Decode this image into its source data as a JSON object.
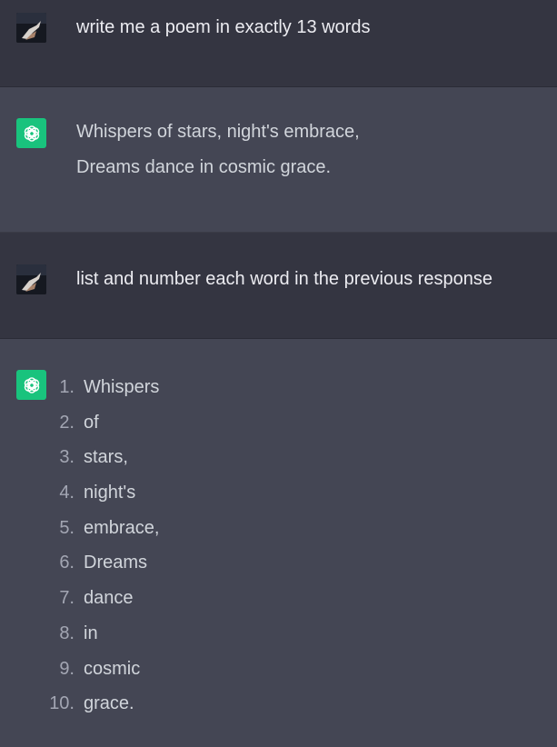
{
  "conversation": [
    {
      "role": "user",
      "lines": [
        "write me a poem in exactly 13 words"
      ]
    },
    {
      "role": "assistant",
      "lines": [
        "Whispers of stars, night's embrace,",
        "Dreams dance in cosmic grace."
      ]
    },
    {
      "role": "user",
      "lines": [
        "list and number each word in the previous response"
      ]
    },
    {
      "role": "assistant",
      "list": [
        {
          "num": "1.",
          "word": "Whispers"
        },
        {
          "num": "2.",
          "word": "of"
        },
        {
          "num": "3.",
          "word": "stars,"
        },
        {
          "num": "4.",
          "word": "night's"
        },
        {
          "num": "5.",
          "word": "embrace,"
        },
        {
          "num": "6.",
          "word": "Dreams"
        },
        {
          "num": "7.",
          "word": "dance"
        },
        {
          "num": "8.",
          "word": "in"
        },
        {
          "num": "9.",
          "word": "cosmic"
        },
        {
          "num": "10.",
          "word": "grace."
        }
      ]
    }
  ],
  "icons": {
    "user_avatar": "user-photo-avatar",
    "assistant_avatar": "openai-logo-icon"
  },
  "colors": {
    "user_bg": "#343541",
    "assistant_bg": "#444654",
    "bot_badge": "#19c37d"
  }
}
